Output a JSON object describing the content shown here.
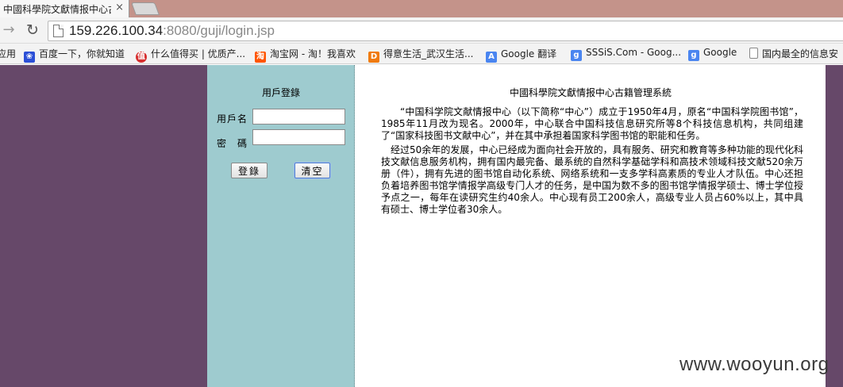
{
  "browser": {
    "tab_title": "中國科學院文獻情报中心古",
    "tab_close": "×",
    "url_host": "159.226.100.34",
    "url_rest": ":8080/guji/login.jsp"
  },
  "bookmarks": [
    {
      "label": "应用",
      "icon": "apps-icon",
      "color": ""
    },
    {
      "label": "百度一下，你就知道",
      "icon": "baidu-icon",
      "color": "#2b4fd6"
    },
    {
      "label": "什么值得买 | 优质产...",
      "icon": "smzdm-icon",
      "color": "#d62f2f"
    },
    {
      "label": "淘宝网 - 淘！我喜欢",
      "icon": "taobao-icon",
      "color": "#ff5500"
    },
    {
      "label": "得意生活_武汉生活...",
      "icon": "deyi-icon",
      "color": "#f07b10"
    },
    {
      "label": "Google 翻译",
      "icon": "google-translate-icon",
      "color": "#4a85f0"
    },
    {
      "label": "SSSiS.Com - Goog...",
      "icon": "google-icon",
      "color": "#4a85f0"
    },
    {
      "label": "Google",
      "icon": "google-icon",
      "color": "#4a85f0"
    },
    {
      "label": "国内最全的信息安",
      "icon": "page-icon",
      "color": ""
    }
  ],
  "login": {
    "title": "用戶登錄",
    "username_label": "用戶名",
    "password_label": "密　碼",
    "username_value": "",
    "password_value": "",
    "login_button": "登錄",
    "clear_button": "清空"
  },
  "content": {
    "title": "中國科學院文獻情报中心古籍管理系統",
    "paragraphs": [
      "“中国科学院文献情报中心（以下简称“中心”）成立于1950年4月，原名“中国科学院图书馆”，1985年11月改为现名。2000年，中心联合中国科技信息研究所等8个科技信息机构，共同组建了“国家科技图书文献中心”，并在其中承担着国家科学图书馆的职能和任务。",
      "经过50余年的发展，中心已经成为面向社会开放的，具有服务、研究和教育等多种功能的现代化科技文献信息服务机构，拥有国内最完备、最系统的自然科学基础学科和高技术领域科技文献520余万册（件），拥有先进的图书馆自动化系统、网络系统和一支多学科高素质的专业人才队伍。中心还担负着培养图书馆学情报学高级专门人才的任务，是中国为数不多的图书馆学情报学硕士、博士学位授予点之一，每年在读研究生约40余人。中心现有员工200余人，高级专业人员占60%以上，其中具有硕士、博士学位者30余人。"
    ]
  },
  "watermark": "www.wooyun.org"
}
